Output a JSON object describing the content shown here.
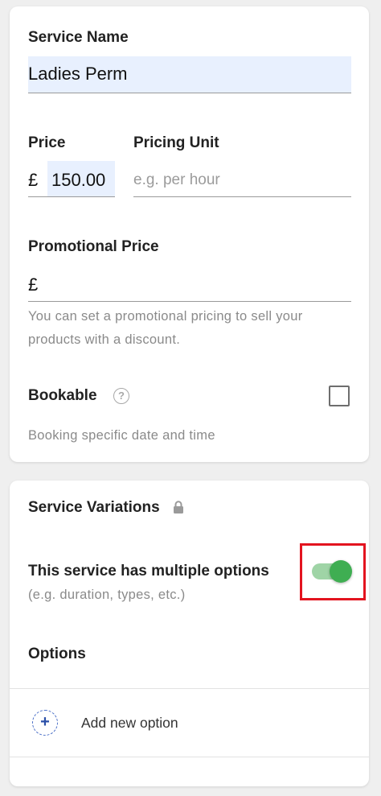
{
  "details": {
    "service_name_label": "Service Name",
    "service_name_value": "Ladies Perm",
    "price_label": "Price",
    "currency_symbol": "£",
    "price_value": "150.00",
    "pricing_unit_label": "Pricing Unit",
    "pricing_unit_placeholder": "e.g. per hour",
    "promo_label": "Promotional Price",
    "promo_currency_symbol": "£",
    "promo_value": "",
    "promo_help_line1": "You can set a promotional pricing to sell your",
    "promo_help_line2": "products with a discount.",
    "bookable_label": "Bookable",
    "bookable_help_icon": "?",
    "bookable_checked": false,
    "bookable_help": "Booking specific date and time"
  },
  "variations": {
    "title": "Service Variations",
    "multiple_options_label": "This service has multiple options",
    "multiple_options_hint": "(e.g. duration, types, etc.)",
    "multiple_options_enabled": true,
    "options_label": "Options",
    "add_option_icon": "+",
    "add_option_label": "Add new option"
  },
  "colors": {
    "toggle_on": "#3fae52",
    "highlight": "#e3141f",
    "autofill_bg": "#e8f0fe",
    "add_icon": "#2a4fa8"
  },
  "icons": {
    "help": "question-circle-icon",
    "lock": "lock-icon",
    "add": "plus-circle-icon"
  }
}
